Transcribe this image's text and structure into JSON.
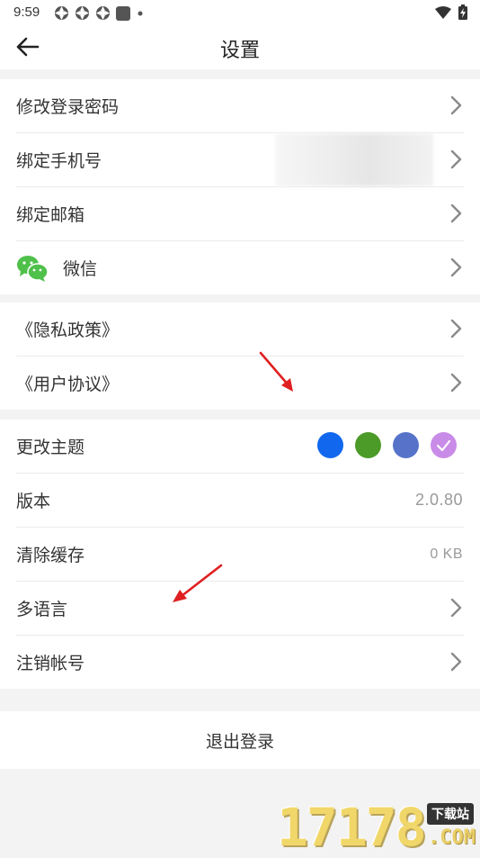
{
  "status_bar": {
    "time": "9:59",
    "icons": [
      "app-notification-icon",
      "app-notification-icon",
      "app-notification-icon",
      "square-notification-icon",
      "dot-icon"
    ],
    "right_icons": [
      "wifi-icon",
      "battery-charging-icon"
    ]
  },
  "header": {
    "title": "设置",
    "back_icon": "arrow-left-icon"
  },
  "account_section": {
    "items": [
      {
        "label": "修改登录密码"
      },
      {
        "label": "绑定手机号"
      },
      {
        "label": "绑定邮箱"
      },
      {
        "label": "微信",
        "icon": "wechat-icon"
      }
    ]
  },
  "legal_section": {
    "items": [
      {
        "label": "《隐私政策》"
      },
      {
        "label": "《用户协议》"
      }
    ]
  },
  "general_section": {
    "theme": {
      "label": "更改主题",
      "colors": [
        "#1168ef",
        "#4c9a28",
        "#5673c9",
        "#c98be8"
      ],
      "selected_index": 3
    },
    "version": {
      "label": "版本",
      "value": "2.0.80"
    },
    "cache": {
      "label": "清除缓存",
      "value": "0 KB"
    },
    "language": {
      "label": "多语言"
    },
    "delete_account": {
      "label": "注销帐号"
    }
  },
  "logout": {
    "label": "退出登录"
  },
  "watermark": {
    "number": "17178",
    "tag": "下载站",
    "domain": ".COM"
  }
}
